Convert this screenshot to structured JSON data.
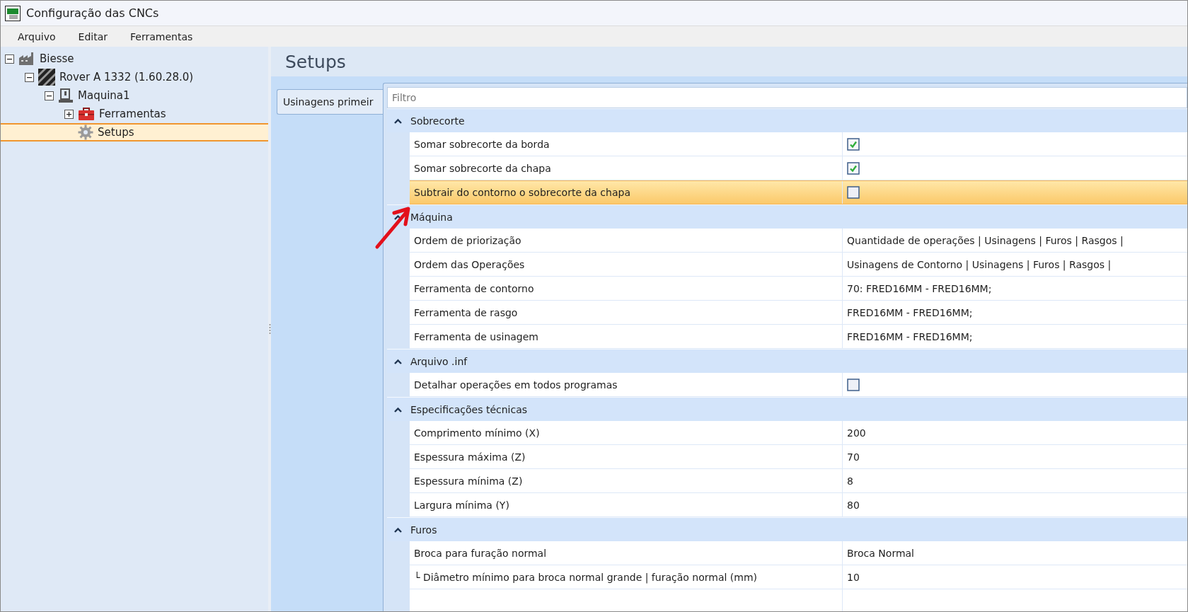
{
  "window": {
    "title": "Configuração das CNCs"
  },
  "menu": [
    "Arquivo",
    "Editar",
    "Ferramentas"
  ],
  "tree": [
    {
      "label": "Biesse",
      "kind": "factory",
      "expanded": true,
      "selected": false,
      "children": [
        {
          "label": "Rover A 1332 (1.60.28.0)",
          "kind": "striped",
          "expanded": true,
          "selected": false,
          "children": [
            {
              "label": "Maquina1",
              "kind": "machine",
              "expanded": true,
              "selected": false,
              "children": [
                {
                  "label": "Ferramentas",
                  "kind": "toolbox",
                  "expanded": false,
                  "selected": false
                },
                {
                  "label": "Setups",
                  "kind": "gear",
                  "selected": true
                }
              ]
            }
          ]
        }
      ]
    }
  ],
  "page_title": "Setups",
  "tabs": [
    {
      "label": "Usinagens primeir",
      "selected": true
    }
  ],
  "filter": {
    "placeholder": "Filtro"
  },
  "groups": [
    {
      "title": "Sobrecorte",
      "expanded": true,
      "rows": [
        {
          "label": "Somar sobrecorte da borda",
          "kind": "checkbox",
          "checked": true,
          "selected": false
        },
        {
          "label": "Somar sobrecorte da chapa",
          "kind": "checkbox",
          "checked": true,
          "selected": false
        },
        {
          "label": "Subtrair do contorno o sobrecorte da chapa",
          "kind": "checkbox",
          "checked": false,
          "selected": true
        }
      ]
    },
    {
      "title": "Máquina",
      "expanded": true,
      "rows": [
        {
          "label": "Ordem de priorização",
          "kind": "text",
          "value": "Quantidade de operações | Usinagens | Furos | Rasgos |",
          "selected": false
        },
        {
          "label": "Ordem das Operações",
          "kind": "text",
          "value": "Usinagens de Contorno | Usinagens | Furos | Rasgos |",
          "selected": false
        },
        {
          "label": "Ferramenta de contorno",
          "kind": "text",
          "value": "70: FRED16MM - FRED16MM;",
          "selected": false
        },
        {
          "label": "Ferramenta de rasgo",
          "kind": "text",
          "value": "FRED16MM - FRED16MM;",
          "selected": false
        },
        {
          "label": "Ferramenta de usinagem",
          "kind": "text",
          "value": "FRED16MM - FRED16MM;",
          "selected": false
        }
      ]
    },
    {
      "title": "Arquivo .inf",
      "expanded": true,
      "rows": [
        {
          "label": "Detalhar operações em todos programas",
          "kind": "checkbox",
          "checked": false,
          "selected": false
        }
      ]
    },
    {
      "title": "Especificações técnicas",
      "expanded": true,
      "rows": [
        {
          "label": "Comprimento mínimo (X)",
          "kind": "text",
          "value": "200",
          "selected": false
        },
        {
          "label": "Espessura máxima (Z)",
          "kind": "text",
          "value": "70",
          "selected": false
        },
        {
          "label": "Espessura mínima (Z)",
          "kind": "text",
          "value": "8",
          "selected": false
        },
        {
          "label": "Largura mínima (Y)",
          "kind": "text",
          "value": "80",
          "selected": false
        }
      ]
    },
    {
      "title": "Furos",
      "expanded": true,
      "rows": [
        {
          "label": "Broca para furação normal",
          "kind": "text",
          "value": "Broca Normal",
          "selected": false
        },
        {
          "label": "└ Diâmetro mínimo para broca normal grande | furação normal (mm)",
          "kind": "text",
          "value": "10",
          "selected": false
        },
        {
          "kind": "cut"
        }
      ]
    }
  ]
}
